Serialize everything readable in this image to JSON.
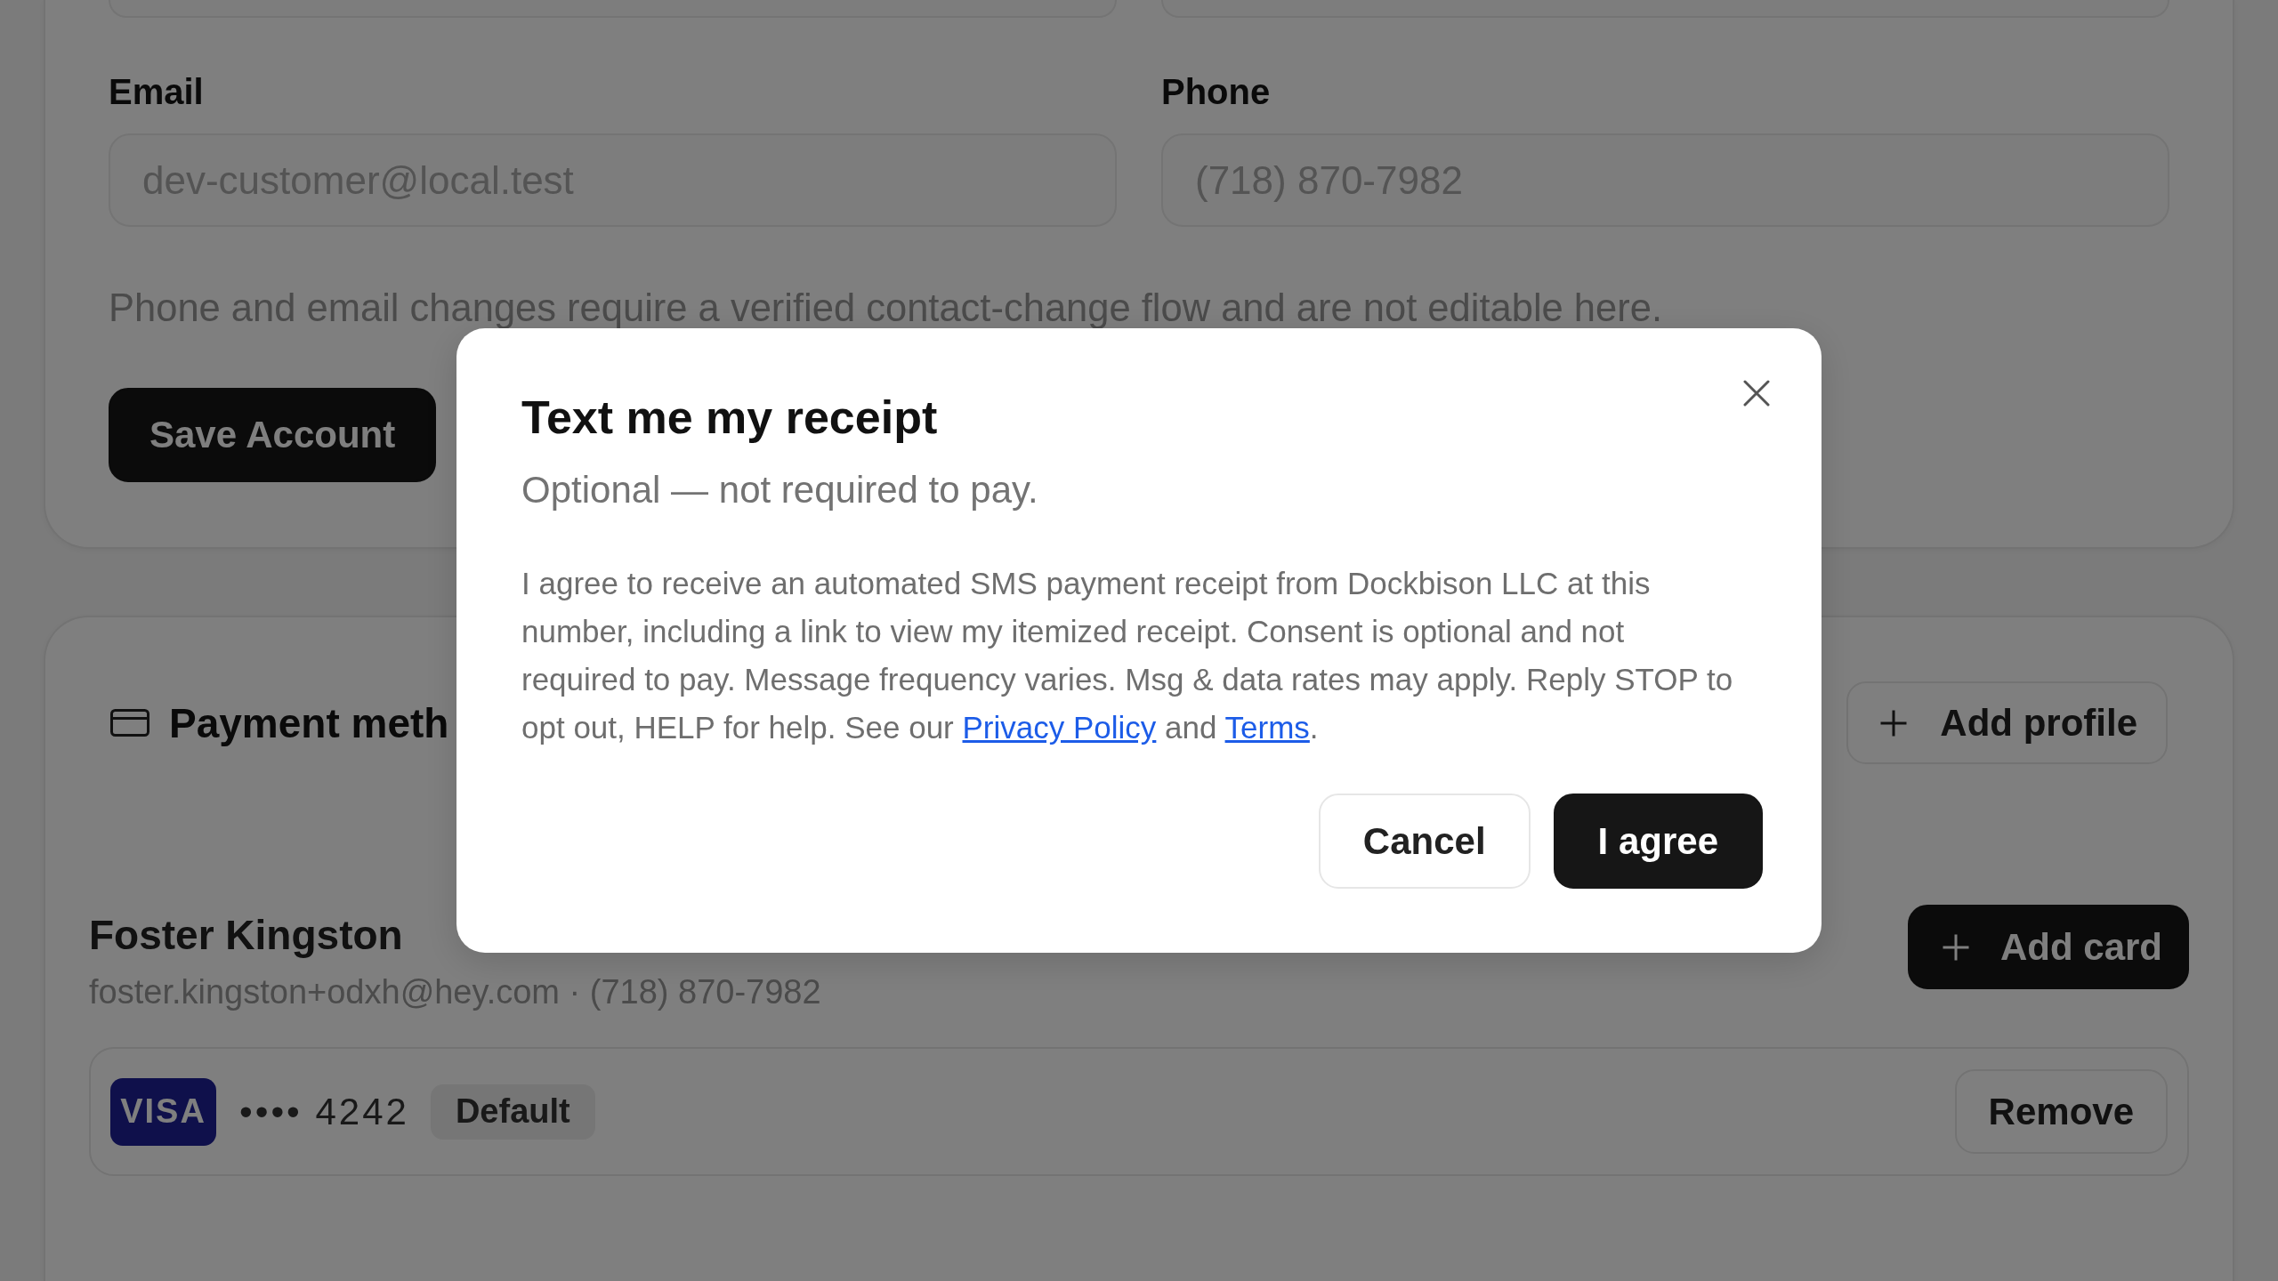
{
  "account_form": {
    "fields": [
      {
        "kind": "clipped"
      },
      {
        "kind": "clipped"
      },
      {
        "kind": "text",
        "label": "Email",
        "value": "dev-customer@local.test",
        "disabled": true
      },
      {
        "kind": "text",
        "label": "Phone",
        "value": "(718) 870-7982",
        "disabled": true
      }
    ],
    "note": "Phone and email changes require a verified contact-change flow and are not editable here.",
    "save_button": "Save Account"
  },
  "payment_methods": {
    "title": "Payment meth",
    "add_profile_button": "Add profile",
    "profiles": [
      {
        "name": "Foster Kingston",
        "contact": "foster.kingston+odxh@hey.com · (718) 870-7982",
        "add_card_button": "Add card",
        "cards": [
          {
            "brand": "VISA",
            "number": "•••• 4242",
            "tag": "Default",
            "remove_button": "Remove"
          }
        ]
      }
    ]
  },
  "modal": {
    "title": "Text me my receipt",
    "subtitle": "Optional — not required to pay.",
    "body": [
      {
        "kind": "text",
        "text": "I agree to receive an automated SMS payment receipt from Dockbison LLC at this number, including a link to view my itemized receipt. Consent is optional and not required to pay. Message frequency varies. Msg & data rates may apply. Reply STOP to opt out, HELP for help. See our "
      },
      {
        "kind": "link",
        "text": "Privacy Policy"
      },
      {
        "kind": "text",
        "text": " and "
      },
      {
        "kind": "link",
        "text": "Terms"
      },
      {
        "kind": "text",
        "text": "."
      }
    ],
    "buttons": [
      {
        "label": "Cancel",
        "kind": "secondary"
      },
      {
        "label": "I agree",
        "kind": "primary"
      }
    ]
  }
}
